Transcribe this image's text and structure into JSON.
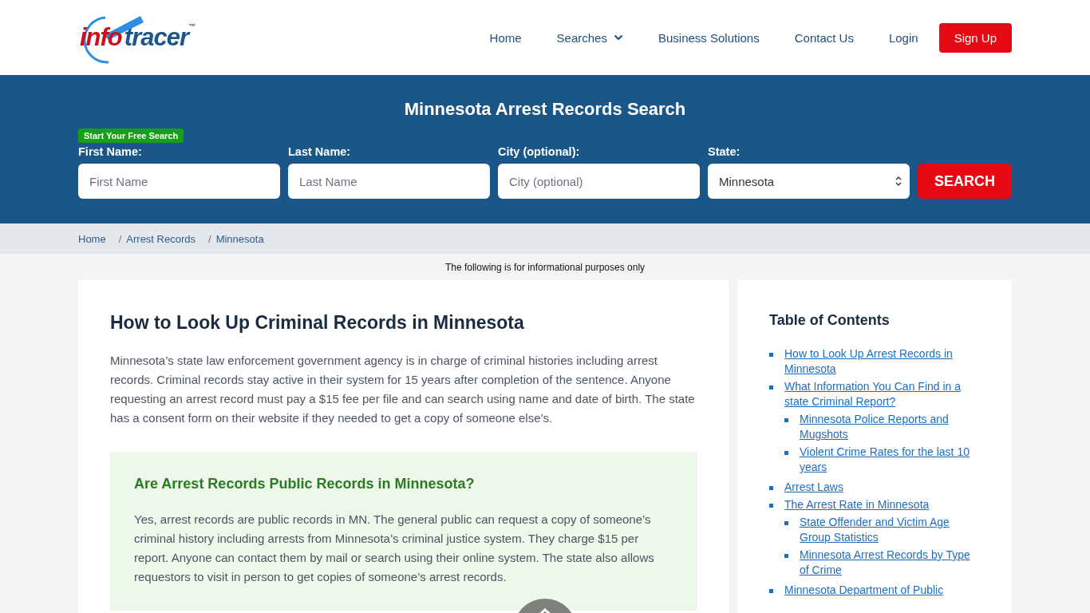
{
  "logo": {
    "part_1": "info",
    "part_2": "tracer",
    "mark": "™"
  },
  "nav": [
    {
      "label": "Home",
      "kind": "link"
    },
    {
      "label": "Searches",
      "kind": "dropdown"
    },
    {
      "label": "Business Solutions",
      "kind": "link"
    },
    {
      "label": "Contact Us",
      "kind": "link"
    },
    {
      "label": "Login",
      "kind": "link"
    },
    {
      "label": "Sign Up",
      "kind": "button"
    }
  ],
  "search": {
    "title": "Minnesota Arrest Records Search",
    "badge": "Start Your Free Search",
    "fields": [
      {
        "label": "First Name:",
        "placeholder": "First Name",
        "kind": "input"
      },
      {
        "label": "Last Name:",
        "placeholder": "Last Name",
        "kind": "input"
      },
      {
        "label": "City (optional):",
        "placeholder": "City (optional)",
        "kind": "input"
      },
      {
        "label": "State:",
        "value": "Minnesota",
        "kind": "select"
      }
    ],
    "button": "SEARCH"
  },
  "breadcrumb": [
    {
      "label": "Home"
    },
    {
      "label": "Arrest Records",
      "separator": "/"
    },
    {
      "label": "Minnesota",
      "separator": "/"
    }
  ],
  "notice": "The following is for informational purposes only",
  "article": {
    "heading": "How to Look Up Criminal Records in Minnesota",
    "paragraph": "Minnesota’s state law enforcement government agency is in charge of criminal histories including arrest records. Criminal records stay active in their system for 15 years after completion of the sentence. Anyone requesting an arrest record must pay a $15 fee per file and can search using name and date of birth. The state has a consent form on their website if they needed to get a copy of someone else’s.",
    "callout": {
      "heading": "Are Arrest Records Public Records in Minnesota?",
      "text": "Yes, arrest records are public records in MN. The general public can request a copy of someone’s criminal history including arrests from Minnesota’s criminal justice system. They charge $15 per report. Anyone can contact them by mail or search using their online system. The state also allows requestors to visit in person to get copies of someone’s arrest records."
    }
  },
  "toc": {
    "title": "Table of Contents",
    "items": [
      {
        "label": "How to Look Up Arrest Records in Minnesota"
      },
      {
        "label": "What Information You Can Find in a state Criminal Report?",
        "children": [
          {
            "label": "Minnesota Police Reports and Mugshots"
          },
          {
            "label": "Violent Crime Rates for the last 10 years"
          }
        ]
      },
      {
        "label": "Arrest Laws"
      },
      {
        "label": "The Arrest Rate in Minnesota",
        "children": [
          {
            "label": "State Offender and Victim Age Group Statistics"
          },
          {
            "label": "Minnesota Arrest Records by Type of Crime"
          }
        ]
      },
      {
        "label": "Minnesota Department of Public"
      }
    ]
  }
}
